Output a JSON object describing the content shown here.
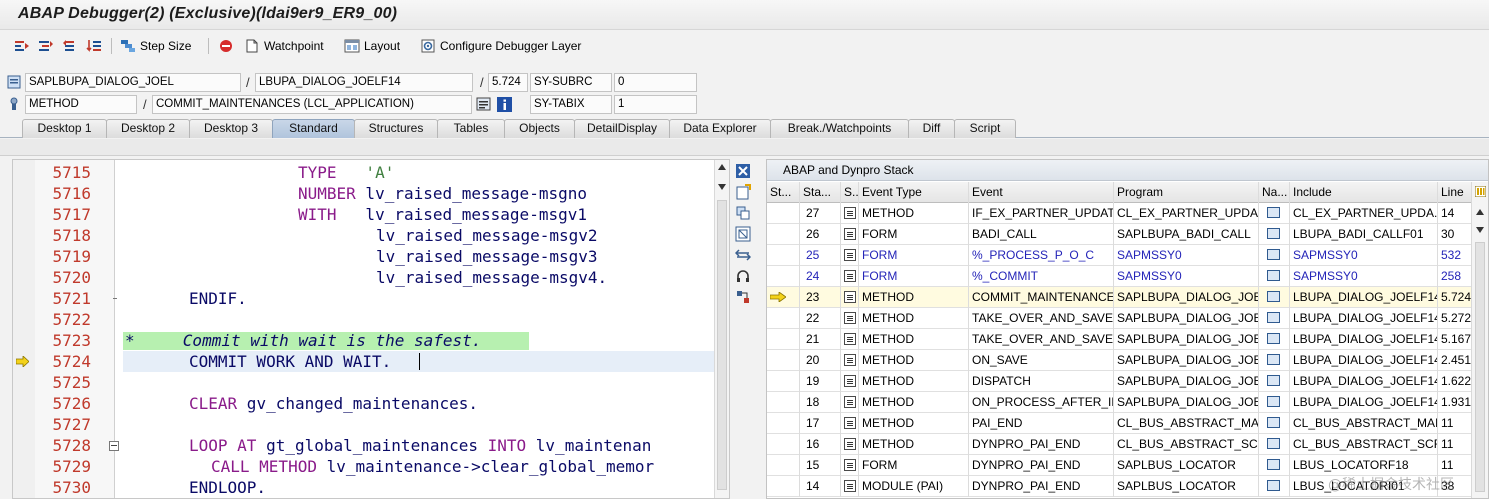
{
  "window_title": "ABAP Debugger(2)  (Exclusive)(ldai9er9_ER9_00)",
  "toolbar": {
    "step_size": "Step Size",
    "watchpoint": "Watchpoint",
    "layout": "Layout",
    "configure": "Configure Debugger Layer"
  },
  "info": {
    "program": "SAPLBUPA_DIALOG_JOEL",
    "include": "LBUPA_DIALOG_JOELF14",
    "line": "5.724",
    "subrc_label": "SY-SUBRC",
    "subrc_value": "0",
    "kind": "METHOD",
    "method": "COMMIT_MAINTENANCES (LCL_APPLICATION)",
    "tabix_label": "SY-TABIX",
    "tabix_value": "1"
  },
  "tabs": [
    "Desktop 1",
    "Desktop 2",
    "Desktop 3",
    "Standard",
    "Structures",
    "Tables",
    "Objects",
    "DetailDisplay",
    "Data Explorer",
    "Break./Watchpoints",
    "Diff",
    "Script"
  ],
  "colors": {
    "accent_tab": "#b0c4dc",
    "line_numbers": "#c0392b",
    "keyword": "#8a1b8a",
    "comment_bg": "#b7f0b0",
    "current_line_bg": "#e6eef8"
  },
  "code": {
    "lines": [
      {
        "n": "5715",
        "kw": "TYPE",
        "rest": "   'A'",
        "type": "type-a"
      },
      {
        "n": "5716",
        "kw": "NUMBER",
        "rest": " lv_raised_message-msgno"
      },
      {
        "n": "5717",
        "kw": "WITH",
        "rest": "   lv_raised_message-msgv1"
      },
      {
        "n": "5718",
        "kw": "",
        "rest": "lv_raised_message-msgv2"
      },
      {
        "n": "5719",
        "kw": "",
        "rest": "lv_raised_message-msgv3"
      },
      {
        "n": "5720",
        "kw": "",
        "rest": "lv_raised_message-msgv4."
      },
      {
        "n": "5721",
        "kw": "ENDIF.",
        "rest": ""
      },
      {
        "n": "5722",
        "kw": "",
        "rest": ""
      },
      {
        "n": "5723",
        "kw": "",
        "rest": "*     Commit with wait is the safest."
      },
      {
        "n": "5724",
        "kw": "COMMIT WORK AND WAIT.",
        "rest": ""
      },
      {
        "n": "5725",
        "kw": "",
        "rest": ""
      },
      {
        "n": "5726",
        "kw": "CLEAR",
        "rest": " gv_changed_maintenances."
      },
      {
        "n": "5727",
        "kw": "",
        "rest": ""
      },
      {
        "n": "5728",
        "kw": "LOOP AT",
        "rest": " gt_global_maintenances ",
        "kw2": "INTO",
        "rest2": " lv_maintenan"
      },
      {
        "n": "5729",
        "kw": "CALL METHOD",
        "rest": " lv_maintenance->clear_global_memor"
      },
      {
        "n": "5730",
        "kw": "ENDLOOP.",
        "rest": ""
      }
    ]
  },
  "stack": {
    "title": "ABAP and Dynpro Stack",
    "headers": [
      "St...",
      "Sta...",
      "S...",
      "Event Type",
      "Event",
      "Program",
      "Na...",
      "Include",
      "Line"
    ],
    "rows": [
      {
        "sta": "27",
        "type": "METHOD",
        "event": "IF_EX_PARTNER_UPDAT...",
        "program": "CL_EX_PARTNER_UPDA...",
        "include": "CL_EX_PARTNER_UPDA...",
        "line": "14"
      },
      {
        "sta": "26",
        "type": "FORM",
        "event": "BADI_CALL",
        "program": "SAPLBUPA_BADI_CALL",
        "include": "LBUPA_BADI_CALLF01",
        "line": "30"
      },
      {
        "sta": "25",
        "type": "FORM",
        "event": "%_PROCESS_P_O_C",
        "program": "SAPMSSY0",
        "include": "SAPMSSY0",
        "line": "532",
        "blue": true
      },
      {
        "sta": "24",
        "type": "FORM",
        "event": "%_COMMIT",
        "program": "SAPMSSY0",
        "include": "SAPMSSY0",
        "line": "258",
        "blue": true
      },
      {
        "sta": "23",
        "type": "METHOD",
        "event": "COMMIT_MAINTENANCES",
        "program": "SAPLBUPA_DIALOG_JOEL",
        "include": "LBUPA_DIALOG_JOELF14",
        "line": "5.724",
        "current": true
      },
      {
        "sta": "22",
        "type": "METHOD",
        "event": "TAKE_OVER_AND_SAVE",
        "program": "SAPLBUPA_DIALOG_JOEL",
        "include": "LBUPA_DIALOG_JOELF14",
        "line": "5.272"
      },
      {
        "sta": "21",
        "type": "METHOD",
        "event": "TAKE_OVER_AND_SAVE...",
        "program": "SAPLBUPA_DIALOG_JOEL",
        "include": "LBUPA_DIALOG_JOELF14",
        "line": "5.167"
      },
      {
        "sta": "20",
        "type": "METHOD",
        "event": "ON_SAVE",
        "program": "SAPLBUPA_DIALOG_JOEL",
        "include": "LBUPA_DIALOG_JOELF14",
        "line": "2.451"
      },
      {
        "sta": "19",
        "type": "METHOD",
        "event": "DISPATCH",
        "program": "SAPLBUPA_DIALOG_JOEL",
        "include": "LBUPA_DIALOG_JOELF14",
        "line": "1.622"
      },
      {
        "sta": "18",
        "type": "METHOD",
        "event": "ON_PROCESS_AFTER_IN...",
        "program": "SAPLBUPA_DIALOG_JOEL",
        "include": "LBUPA_DIALOG_JOELF14",
        "line": "1.931"
      },
      {
        "sta": "17",
        "type": "METHOD",
        "event": "PAI_END",
        "program": "CL_BUS_ABSTRACT_MAI...",
        "include": "CL_BUS_ABSTRACT_MAI...",
        "line": "11"
      },
      {
        "sta": "16",
        "type": "METHOD",
        "event": "DYNPRO_PAI_END",
        "program": "CL_BUS_ABSTRACT_SCR...",
        "include": "CL_BUS_ABSTRACT_SCR...",
        "line": "11"
      },
      {
        "sta": "15",
        "type": "FORM",
        "event": "DYNPRO_PAI_END",
        "program": "SAPLBUS_LOCATOR",
        "include": "LBUS_LOCATORF18",
        "line": "11"
      },
      {
        "sta": "14",
        "type": "MODULE (PAI)",
        "event": "DYNPRO_PAI_END",
        "program": "SAPLBUS_LOCATOR",
        "include": "LBUS_LOCATORI01",
        "line": "38"
      }
    ]
  },
  "watermark": "@稀土掘金技术社区"
}
